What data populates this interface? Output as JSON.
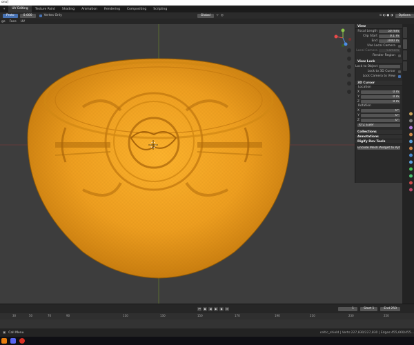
{
  "window": {
    "title": "ono]"
  },
  "workspace_tabs": [
    "UV Editing",
    "Texture Paint",
    "Shading",
    "Animation",
    "Rendering",
    "Compositing",
    "Scripting"
  ],
  "workspace_first_label": "UV Editing",
  "header": {
    "mode": "Proto",
    "value": "0.000",
    "vertex_only_label": "Vertex Only",
    "transform_orientation": "Global",
    "options_label": "Options"
  },
  "header2": {
    "items": [
      "ge",
      "Face",
      "UV"
    ]
  },
  "npanel": {
    "view_title": "View",
    "focal_length_label": "Focal Length",
    "focal_length_value": "50 mm",
    "clip_start_label": "Clip Start",
    "clip_start_value": "0.1 m",
    "end_label": "End",
    "end_value": "1000 m",
    "use_local_camera": "Use Local Camera",
    "local_camera_label": "Local Camera",
    "local_camera_value": "Camera",
    "render_region": "Render Region",
    "view_lock_title": "View Lock",
    "lock_to_object": "Lock to Object",
    "lock_to_3d_cursor": "Lock to 3D Cursor",
    "lock_camera_to_view": "Lock Camera to View",
    "cursor_title": "3D Cursor",
    "location_label": "Location",
    "x_label": "X",
    "x_value": "0 m",
    "y_label": "Y",
    "y_value": "0 m",
    "z_label": "Z",
    "z_value": "0 m",
    "rotation_label": "Rotation",
    "rx_value": "0°",
    "ry_value": "0°",
    "rz_value": "0°",
    "rotation_mode": "XYZ Euler",
    "collections": "Collections",
    "annotations": "Annotations",
    "rigify": "Rigify Dev Tools",
    "encode_button": "Encode Mesh Widget to Python"
  },
  "timeline": {
    "current_frame": "1",
    "start_label": "Start",
    "start_value": "1",
    "end_label": "End",
    "end_value": "250",
    "ticks": [
      "30",
      "50",
      "70",
      "90",
      "110",
      "130",
      "150",
      "170",
      "190",
      "210",
      "230",
      "250"
    ]
  },
  "status": {
    "call_menu": "Call Menu",
    "stats": "celtic_shield | Verts:227,830/227,830 | Edges:455,660/455..."
  },
  "colors": {
    "accent": "#4772b3",
    "mesh_orange": "#f5a623",
    "viewport_bg": "#3d3d3d"
  }
}
